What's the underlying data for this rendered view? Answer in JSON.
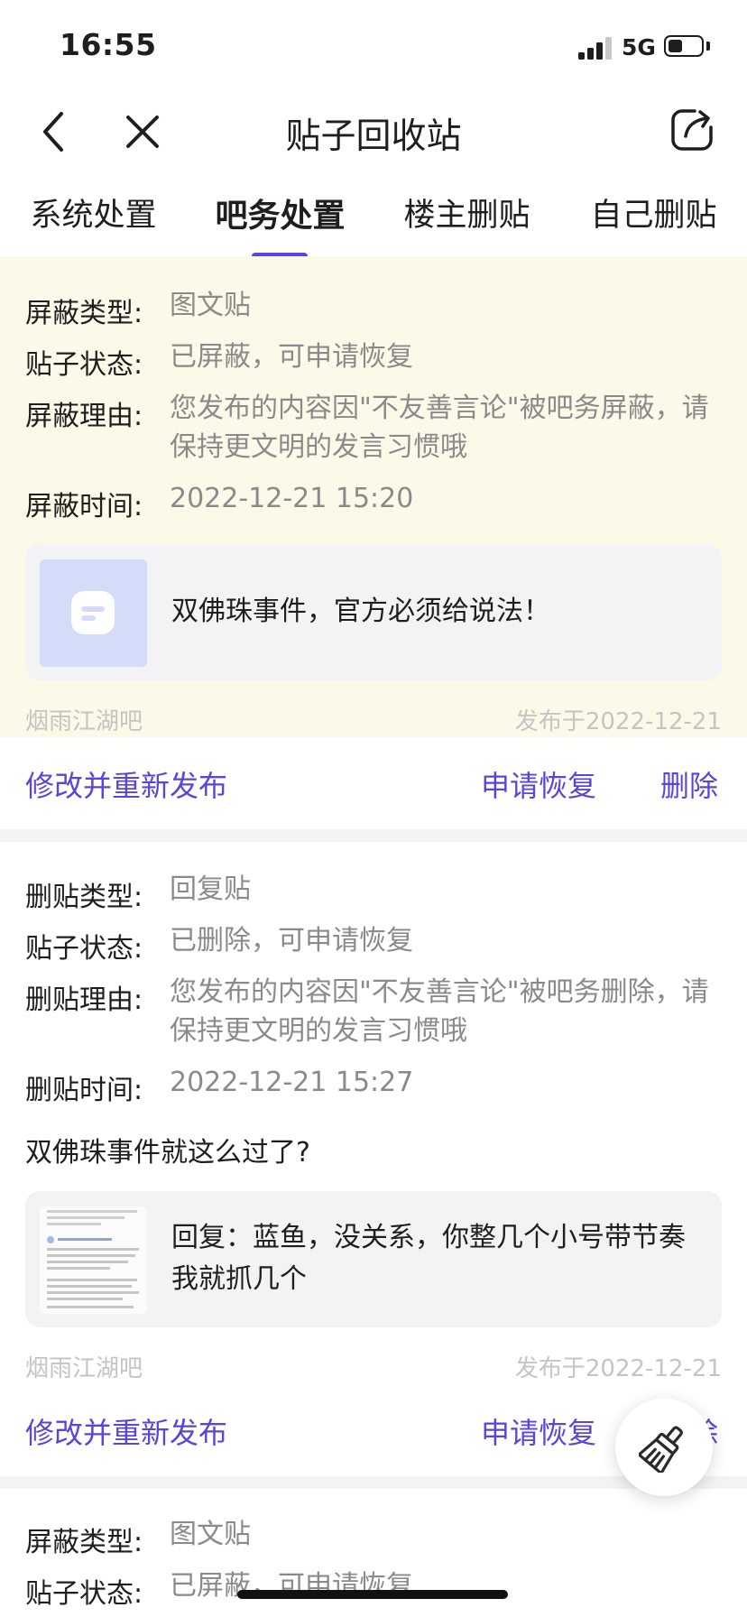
{
  "status_bar": {
    "time": "16:55",
    "network": "5G",
    "battery_percent": 45
  },
  "nav": {
    "title": "贴子回收站",
    "back_icon": "chevron-left-icon",
    "close_icon": "close-icon",
    "share_icon": "share-icon"
  },
  "tabs": [
    {
      "label": "系统处置",
      "active": false
    },
    {
      "label": "吧务处置",
      "active": true
    },
    {
      "label": "楼主删贴",
      "active": false
    },
    {
      "label": "自己删贴",
      "active": false
    }
  ],
  "accent_color": "#5b45d8",
  "posts": [
    {
      "highlighted": true,
      "fields": [
        {
          "label": "屏蔽类型:",
          "value": "图文贴"
        },
        {
          "label": "贴子状态:",
          "value": "已屏蔽，可申请恢复"
        },
        {
          "label": "屏蔽理由:",
          "value": "您发布的内容因\"不友善言论\"被吧务屏蔽，请保持更文明的发言习惯哦"
        },
        {
          "label": "屏蔽时间:",
          "value": "2022-12-21 15:20"
        }
      ],
      "preview_text": "双佛珠事件，官方必须给说法！",
      "forum": "烟雨江湖吧",
      "published": "发布于2022-12-21",
      "actions": {
        "edit": "修改并重新发布",
        "restore": "申请恢复",
        "delete": "删除"
      }
    },
    {
      "highlighted": false,
      "fields": [
        {
          "label": "删贴类型:",
          "value": "回复贴"
        },
        {
          "label": "贴子状态:",
          "value": "已删除，可申请恢复"
        },
        {
          "label": "删贴理由:",
          "value": "您发布的内容因\"不友善言论\"被吧务删除，请保持更文明的发言习惯哦"
        },
        {
          "label": "删贴时间:",
          "value": "2022-12-21 15:27"
        }
      ],
      "quote": "双佛珠事件就这么过了?",
      "preview_text": "回复：蓝鱼，没关系，你整几个小号带节奏我就抓几个",
      "forum": "烟雨江湖吧",
      "published": "发布于2022-12-21",
      "actions": {
        "edit": "修改并重新发布",
        "restore": "申请恢复",
        "delete": "除"
      }
    },
    {
      "highlighted": false,
      "fields": [
        {
          "label": "屏蔽类型:",
          "value": "图文贴"
        },
        {
          "label": "贴子状态:",
          "value": "已屏蔽，可申请恢复"
        }
      ]
    }
  ],
  "fab": {
    "icon": "broom-icon"
  }
}
